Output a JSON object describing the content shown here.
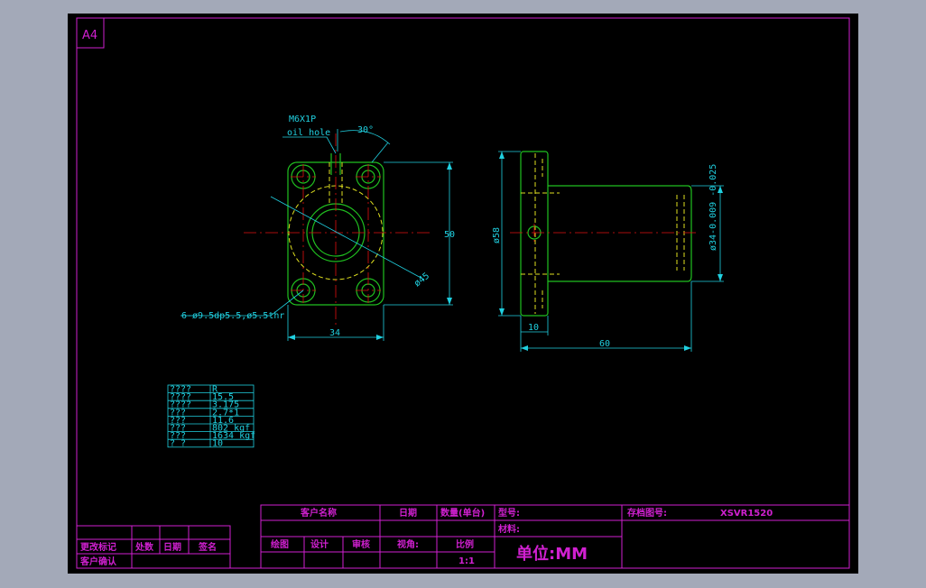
{
  "sheet": {
    "size_label": "A4"
  },
  "front_view": {
    "oil_hole_spec": "M6X1P",
    "oil_hole_label": "oil hole",
    "angle": "30°",
    "height_dim": "50",
    "width_dim": "34",
    "pcd_dim": "ø45",
    "hole_note": "6-ø9.5dp5.5,ø5.5thr"
  },
  "side_view": {
    "flange_dia": "ø58",
    "body_dia": "ø34-0.009 -0.025",
    "flange_thk": "10",
    "length": "60"
  },
  "spec_table": {
    "rows": [
      [
        "????",
        "R"
      ],
      [
        "????",
        "15.5"
      ],
      [
        "????",
        "3.175"
      ],
      [
        "???",
        "2.7*1"
      ],
      [
        "???",
        "11.6"
      ],
      [
        "???",
        "802  kgf"
      ],
      [
        "???",
        "1634  kgf"
      ],
      [
        "?  ?",
        "10"
      ]
    ]
  },
  "title_block": {
    "customer_name": "客户名称",
    "date": "日期",
    "quantity": "数量(单台)",
    "model": "型号:",
    "archive_no": "存档图号:",
    "archive_value": "XSVR1520",
    "material": "材料:",
    "draw": "绘图",
    "design": "设计",
    "review": "审核",
    "view_angle": "视角:",
    "scale_label": "比例",
    "scale_value": "1:1",
    "unit": "单位:MM"
  },
  "revision_block": {
    "change_mark": "更改标记",
    "count": "处数",
    "date": "日期",
    "sign": "签名",
    "customer_confirm": "客户确认"
  }
}
